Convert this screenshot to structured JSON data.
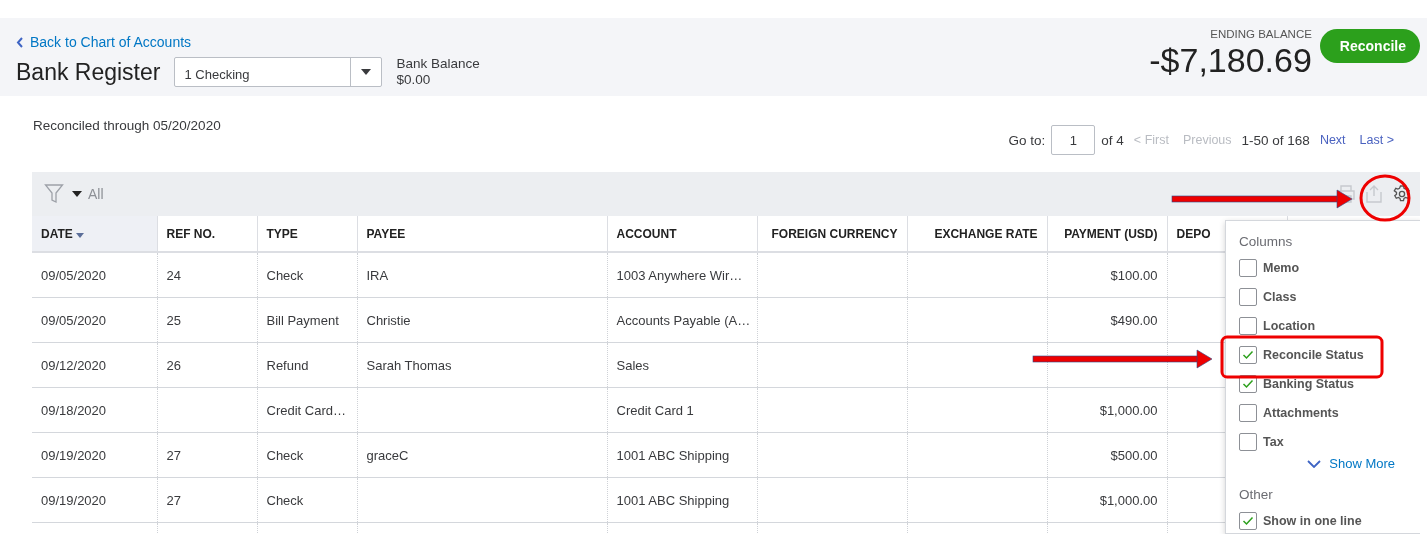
{
  "back_link": {
    "label": "Back to Chart of Accounts"
  },
  "title": "Bank Register",
  "account_select": {
    "value": "1 Checking"
  },
  "bank_balance": {
    "label": "Bank Balance",
    "value": "$0.00"
  },
  "ending_balance": {
    "label": "ENDING BALANCE",
    "value": "-$7,180.69"
  },
  "reconcile_button": {
    "label": "Reconcile"
  },
  "reconciled_through": "Reconciled through 05/20/2020",
  "pager": {
    "goto_label": "Go to:",
    "page": "1",
    "of": "of 4",
    "first": {
      "label": "< First",
      "disabled": true
    },
    "previous": {
      "label": "Previous",
      "disabled": true
    },
    "range": "1-50 of 168",
    "next": {
      "label": "Next",
      "disabled": false
    },
    "last": {
      "label": "Last >",
      "disabled": false
    }
  },
  "filter": {
    "label": "All"
  },
  "table": {
    "columns": [
      {
        "label": "DATE",
        "sorted": true,
        "kind": "text"
      },
      {
        "label": "REF NO.",
        "sorted": false,
        "kind": "text"
      },
      {
        "label": "TYPE",
        "sorted": false,
        "kind": "text"
      },
      {
        "label": "PAYEE",
        "sorted": false,
        "kind": "text"
      },
      {
        "label": "ACCOUNT",
        "sorted": false,
        "kind": "text"
      },
      {
        "label": "FOREIGN CURRENCY",
        "sorted": false,
        "kind": "amount"
      },
      {
        "label": "EXCHANGE RATE",
        "sorted": false,
        "kind": "amount"
      },
      {
        "label": "PAYMENT (USD)",
        "sorted": false,
        "kind": "amount"
      },
      {
        "label": "DEPO",
        "sorted": false,
        "kind": "text"
      }
    ],
    "rows": [
      {
        "date": "09/05/2020",
        "ref_no": "24",
        "type": "Check",
        "payee": "IRA",
        "account": "1003 Anywhere Wir…",
        "payment": "$100.00"
      },
      {
        "date": "09/05/2020",
        "ref_no": "25",
        "type": "Bill Payment",
        "payee": "Christie",
        "account": "Accounts Payable (A…",
        "payment": "$490.00"
      },
      {
        "date": "09/12/2020",
        "ref_no": "26",
        "type": "Refund",
        "payee": "Sarah Thomas",
        "account": "Sales"
      },
      {
        "date": "09/18/2020",
        "type": "Credit Card…",
        "account": "Credit Card 1",
        "payment": "$1,000.00"
      },
      {
        "date": "09/19/2020",
        "ref_no": "27",
        "type": "Check",
        "payee": "graceC",
        "account": "1001 ABC Shipping",
        "payment": "$500.00"
      },
      {
        "date": "09/19/2020",
        "ref_no": "27",
        "type": "Check",
        "account": "1001 ABC Shipping",
        "payment": "$1,000.00"
      }
    ]
  },
  "settings_dropdown": {
    "columns_heading": "Columns",
    "columns": [
      {
        "label": "Memo",
        "checked": false
      },
      {
        "label": "Class",
        "checked": false
      },
      {
        "label": "Location",
        "checked": false
      },
      {
        "label": "Reconcile Status",
        "checked": true
      },
      {
        "label": "Banking Status",
        "checked": true
      },
      {
        "label": "Attachments",
        "checked": false
      },
      {
        "label": "Tax",
        "checked": false
      }
    ],
    "show_more": "Show More",
    "other_heading": "Other",
    "other": [
      {
        "label": "Show in one line",
        "checked": true
      }
    ]
  }
}
